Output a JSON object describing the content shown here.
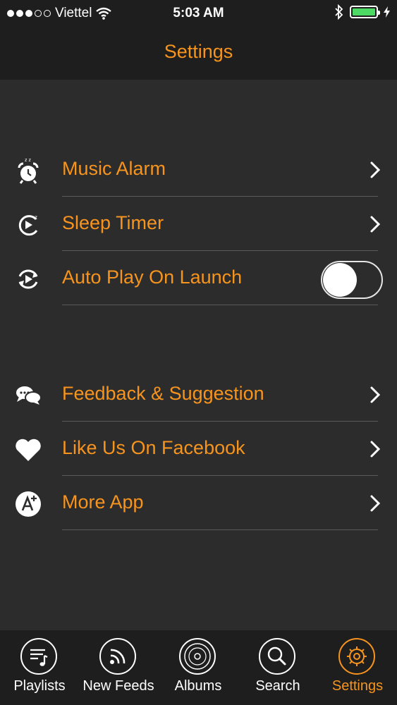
{
  "status_bar": {
    "carrier": "Viettel",
    "time": "5:03 AM",
    "signal_strength": 3,
    "signal_max": 5,
    "battery_level": 1.0,
    "icons": [
      "wifi-icon",
      "bluetooth-icon",
      "battery-icon",
      "charging-icon"
    ]
  },
  "nav": {
    "title": "Settings"
  },
  "groups": [
    {
      "rows": [
        {
          "label": "Music Alarm",
          "icon": "alarm-clock-icon",
          "accessory": "chevron"
        },
        {
          "label": "Sleep Timer",
          "icon": "sleep-timer-icon",
          "accessory": "chevron"
        },
        {
          "label": "Auto Play On Launch",
          "icon": "auto-play-icon",
          "accessory": "toggle",
          "toggle_on": false
        }
      ]
    },
    {
      "rows": [
        {
          "label": "Feedback & Suggestion",
          "icon": "chat-bubbles-icon",
          "accessory": "chevron"
        },
        {
          "label": "Like Us On Facebook",
          "icon": "heart-icon",
          "accessory": "chevron"
        },
        {
          "label": "More App",
          "icon": "app-store-icon",
          "accessory": "chevron"
        }
      ]
    }
  ],
  "tab_bar": {
    "tabs": [
      {
        "label": "Playlists",
        "icon": "playlist-icon",
        "active": false
      },
      {
        "label": "New Feeds",
        "icon": "rss-feed-icon",
        "active": false
      },
      {
        "label": "Albums",
        "icon": "vinyl-record-icon",
        "active": false
      },
      {
        "label": "Search",
        "icon": "search-icon",
        "active": false
      },
      {
        "label": "Settings",
        "icon": "gear-icon",
        "active": true
      }
    ]
  },
  "colors": {
    "accent": "#f7941d",
    "background": "#2c2c2c",
    "bar_background": "#1e1e1e",
    "divider": "#5a5a5a",
    "battery": "#4cd964"
  }
}
